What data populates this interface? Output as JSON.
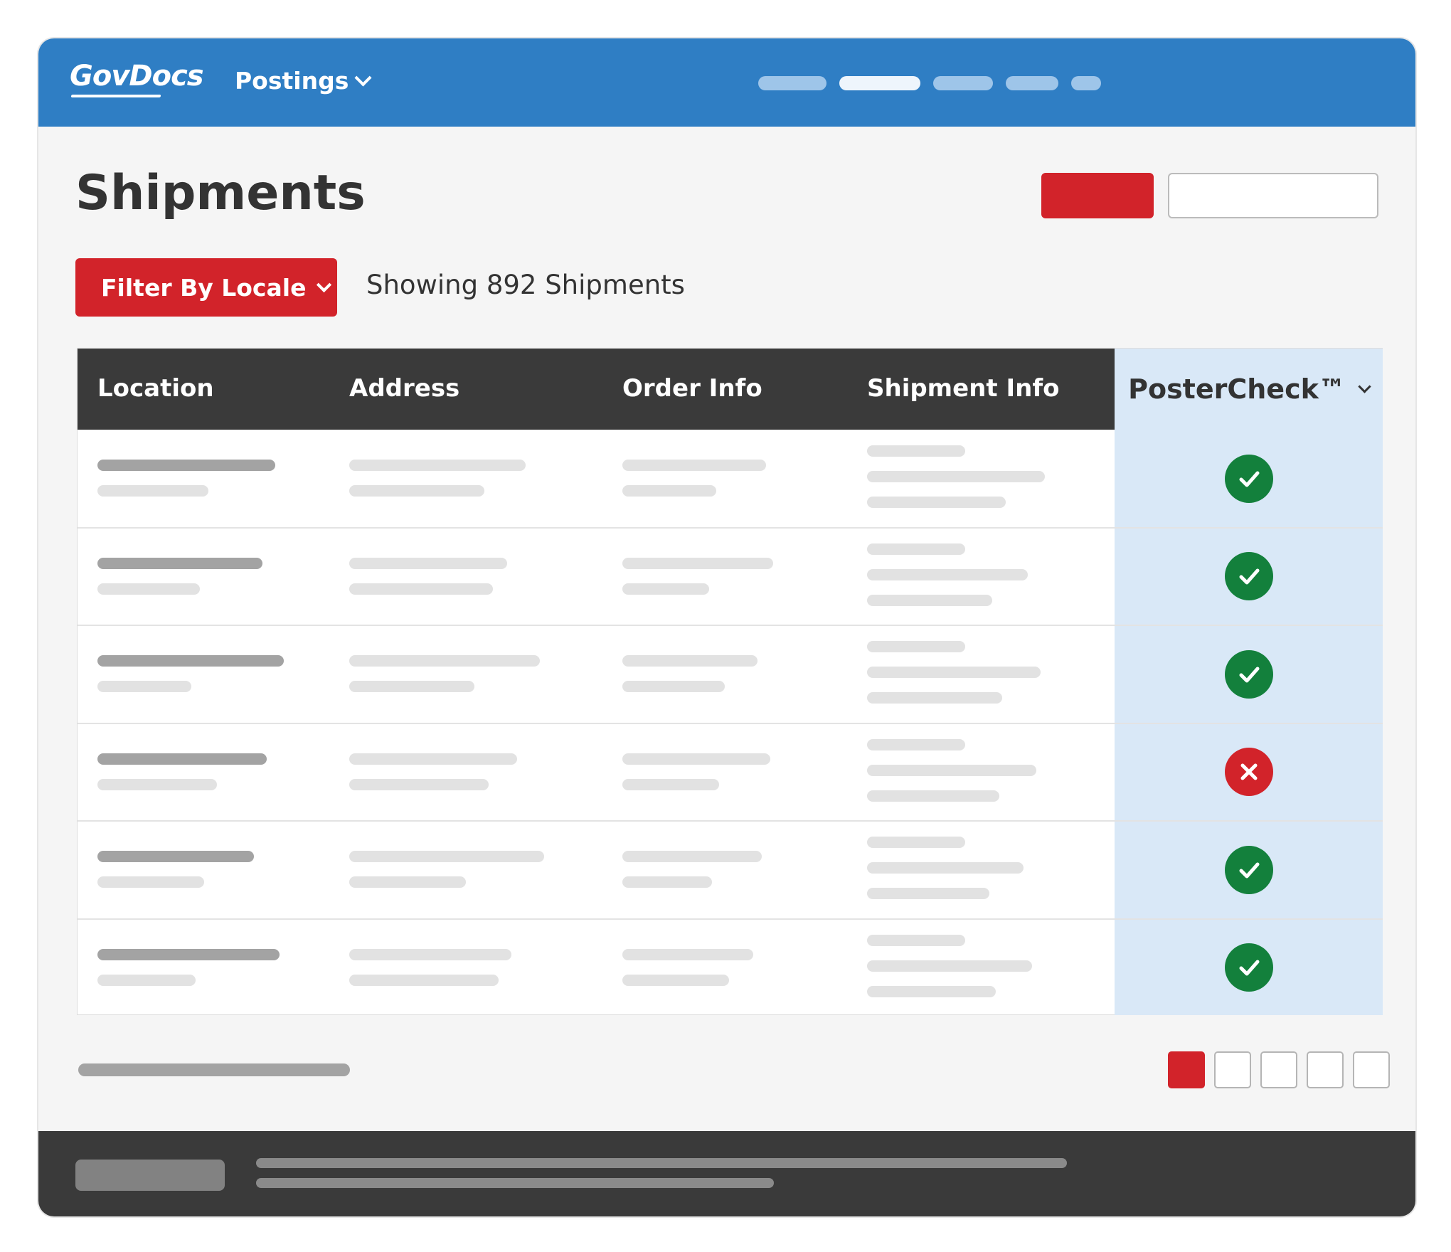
{
  "app": {
    "logo": "GovDocs"
  },
  "nav": {
    "menu_label": "Postings"
  },
  "page": {
    "title": "Shipments",
    "showing_text": "Showing 892 Shipments"
  },
  "filter": {
    "label": "Filter By Locale"
  },
  "table": {
    "headers": [
      "Location",
      "Address",
      "Order Info",
      "Shipment Info",
      "PosterCheck™"
    ],
    "statuses": [
      "ok",
      "ok",
      "ok",
      "fail",
      "ok",
      "ok"
    ]
  },
  "pagination": {
    "active_page": 1,
    "page_count": 5
  },
  "colors": {
    "brand_blue": "#2f7ec4",
    "accent_red": "#d2232a",
    "ok_green": "#13803c",
    "header_dark": "#3a3a3a"
  },
  "icons": {
    "ok": "check-circle-icon",
    "fail": "x-circle-icon",
    "dropdown": "chevron-down-icon"
  }
}
